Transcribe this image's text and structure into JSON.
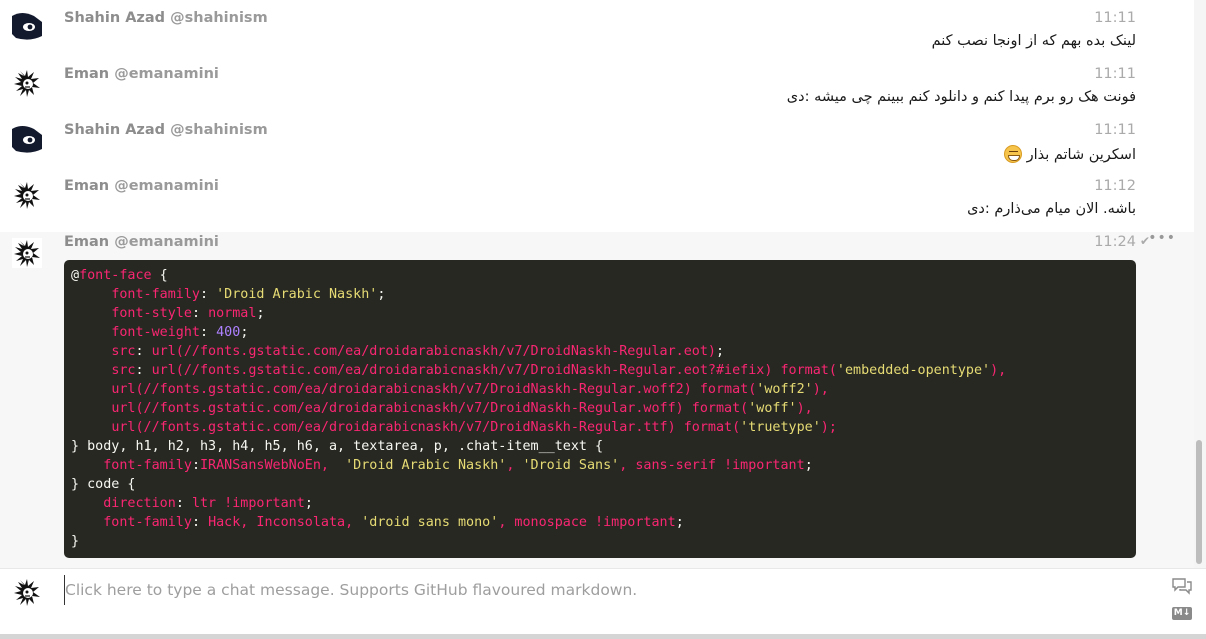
{
  "messages": [
    {
      "name": "Shahin Azad",
      "handle": "@shahinism",
      "time": "11:11",
      "text": "لینک بده بهم که از اونجا نصب کنم"
    },
    {
      "name": "Eman",
      "handle": "@emanamini",
      "time": "11:11",
      "text": "فونت هک رو برم پیدا کنم و دانلود کنم ببینم چی میشه :دی"
    },
    {
      "name": "Shahin Azad",
      "handle": "@shahinism",
      "time": "11:11",
      "text": "اسکرین شاتم بذار"
    },
    {
      "name": "Eman",
      "handle": "@emanamini",
      "time": "11:12",
      "text": "باشه. الان میام می‌ذارم :دی"
    },
    {
      "name": "Eman",
      "handle": "@emanamini",
      "time": "11:24"
    }
  ],
  "icons": {
    "emoji": "grinning-face-icon",
    "read": "checkmark-icon",
    "more": "more-options-icon",
    "chat": "chat-bubbles-icon",
    "markdown": "markdown-icon"
  },
  "code": {
    "lines": [
      [
        {
          "t": "@",
          "c": ""
        },
        {
          "t": "font-face",
          "c": "c-prop"
        },
        {
          "t": " {",
          "c": ""
        }
      ],
      [
        {
          "t": "     ",
          "c": ""
        },
        {
          "t": "font-family",
          "c": "c-prop"
        },
        {
          "t": ": ",
          "c": ""
        },
        {
          "t": "'Droid Arabic Naskh'",
          "c": "c-str"
        },
        {
          "t": ";",
          "c": ""
        }
      ],
      [
        {
          "t": "     ",
          "c": ""
        },
        {
          "t": "font-style",
          "c": "c-prop"
        },
        {
          "t": ": ",
          "c": ""
        },
        {
          "t": "normal",
          "c": "c-prop"
        },
        {
          "t": ";",
          "c": ""
        }
      ],
      [
        {
          "t": "     ",
          "c": ""
        },
        {
          "t": "font-weight",
          "c": "c-prop"
        },
        {
          "t": ": ",
          "c": ""
        },
        {
          "t": "400",
          "c": "c-num"
        },
        {
          "t": ";",
          "c": ""
        }
      ],
      [
        {
          "t": "     ",
          "c": ""
        },
        {
          "t": "src",
          "c": "c-prop"
        },
        {
          "t": ": ",
          "c": ""
        },
        {
          "t": "url(//fonts.gstatic.com/ea/droidarabicnaskh/v7/DroidNaskh-Regular.eot)",
          "c": "c-prop"
        },
        {
          "t": ";",
          "c": ""
        }
      ],
      [
        {
          "t": "     ",
          "c": ""
        },
        {
          "t": "src",
          "c": "c-prop"
        },
        {
          "t": ": ",
          "c": ""
        },
        {
          "t": "url(//fonts.gstatic.com/ea/droidarabicnaskh/v7/DroidNaskh-Regular.eot?#iefix) format(",
          "c": "c-prop"
        },
        {
          "t": "'embedded-opentype'",
          "c": "c-str"
        },
        {
          "t": "),",
          "c": "c-prop"
        }
      ],
      [
        {
          "t": "     ",
          "c": ""
        },
        {
          "t": "url(//fonts.gstatic.com/ea/droidarabicnaskh/v7/DroidNaskh-Regular.woff2) format(",
          "c": "c-prop"
        },
        {
          "t": "'woff2'",
          "c": "c-str"
        },
        {
          "t": "),",
          "c": "c-prop"
        }
      ],
      [
        {
          "t": "     ",
          "c": ""
        },
        {
          "t": "url(//fonts.gstatic.com/ea/droidarabicnaskh/v7/DroidNaskh-Regular.woff) format(",
          "c": "c-prop"
        },
        {
          "t": "'woff'",
          "c": "c-str"
        },
        {
          "t": "),",
          "c": "c-prop"
        }
      ],
      [
        {
          "t": "     ",
          "c": ""
        },
        {
          "t": "url(//fonts.gstatic.com/ea/droidarabicnaskh/v7/DroidNaskh-Regular.ttf) format(",
          "c": "c-prop"
        },
        {
          "t": "'truetype'",
          "c": "c-str"
        },
        {
          "t": ");",
          "c": "c-prop"
        }
      ],
      [
        {
          "t": "} body, h1, h2, h3, h4, h5, h6, a, textarea, p, .chat-item__text {",
          "c": ""
        }
      ],
      [
        {
          "t": "    ",
          "c": ""
        },
        {
          "t": "font-family",
          "c": "c-prop"
        },
        {
          "t": ":",
          "c": ""
        },
        {
          "t": "IRANSansWebNoEn,  ",
          "c": "c-prop"
        },
        {
          "t": "'Droid Arabic Naskh'",
          "c": "c-str"
        },
        {
          "t": ", ",
          "c": "c-prop"
        },
        {
          "t": "'Droid Sans'",
          "c": "c-str"
        },
        {
          "t": ", sans-serif !important",
          "c": "c-prop"
        },
        {
          "t": ";",
          "c": ""
        }
      ],
      [
        {
          "t": "} code {",
          "c": ""
        }
      ],
      [
        {
          "t": "    ",
          "c": ""
        },
        {
          "t": "direction",
          "c": "c-prop"
        },
        {
          "t": ": ",
          "c": ""
        },
        {
          "t": "ltr !important",
          "c": "c-prop"
        },
        {
          "t": ";",
          "c": ""
        }
      ],
      [
        {
          "t": "    ",
          "c": ""
        },
        {
          "t": "font-family",
          "c": "c-prop"
        },
        {
          "t": ": ",
          "c": ""
        },
        {
          "t": "Hack, Inconsolata, ",
          "c": "c-prop"
        },
        {
          "t": "'droid sans mono'",
          "c": "c-str"
        },
        {
          "t": ", monospace !important",
          "c": "c-prop"
        },
        {
          "t": ";",
          "c": ""
        }
      ],
      [
        {
          "t": "}",
          "c": ""
        }
      ]
    ]
  },
  "composer": {
    "placeholder": "Click here to type a chat message. Supports GitHub flavoured markdown.",
    "markdown_label": "M↓"
  },
  "colors": {
    "code_bg": "#272822",
    "code_property": "#f92672",
    "code_string": "#e6db74",
    "code_number": "#ae81ff"
  }
}
